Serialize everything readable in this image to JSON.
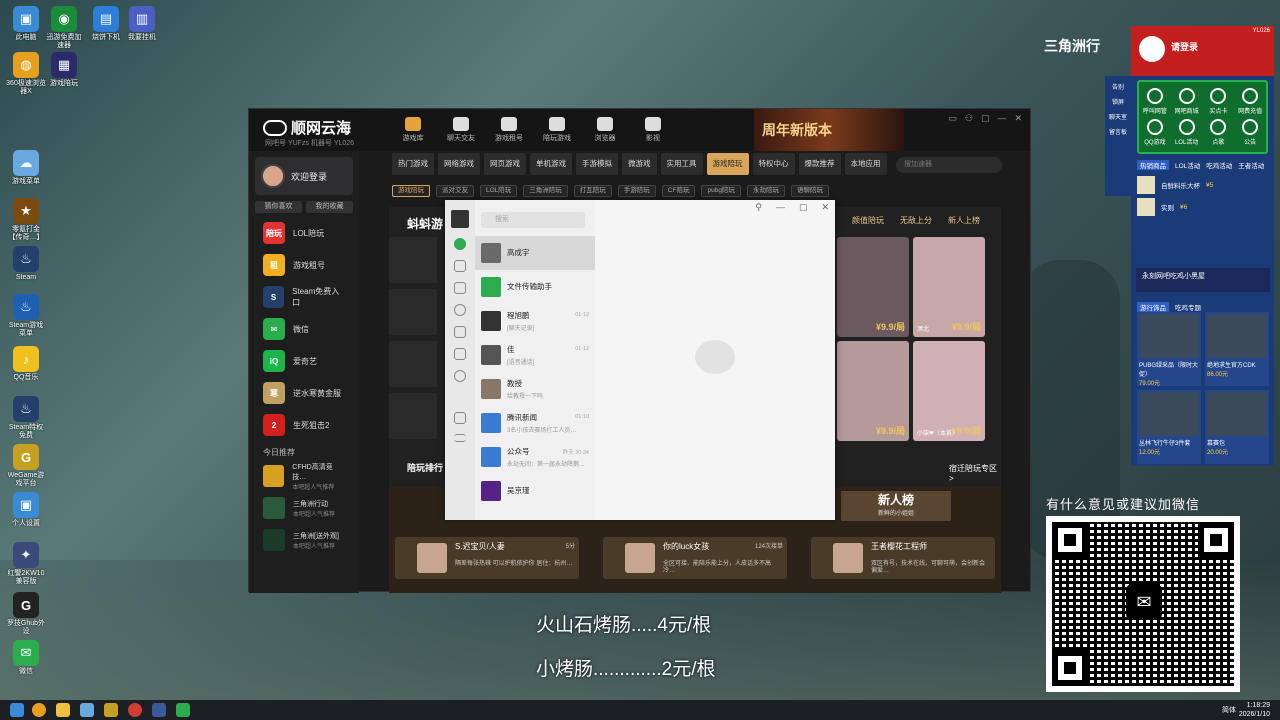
{
  "desktop": {
    "icons": [
      {
        "label": "此电脑",
        "color": "#3a8bd6",
        "glyph": "▣"
      },
      {
        "label": "迅游免费加速器",
        "color": "#1b8c3a",
        "glyph": "◉"
      },
      {
        "label": "烧饼下机",
        "color": "#2d7ed6",
        "glyph": "▤"
      },
      {
        "label": "我要挂机",
        "color": "#4a5fc4",
        "glyph": "▥"
      },
      {
        "label": "360极速浏览器X",
        "color": "#e6a020",
        "glyph": "◍"
      },
      {
        "label": "游戏陪玩",
        "color": "#2b2b6a",
        "glyph": "▦"
      },
      {
        "label": "游戏菜单",
        "color": "#6aa8e0",
        "glyph": "☁"
      },
      {
        "label": "零氪打金【传奇…】",
        "color": "#7a4a10",
        "glyph": "★"
      },
      {
        "label": "Steam",
        "color": "#23406a",
        "glyph": "♨"
      },
      {
        "label": "Steam游戏菜单",
        "color": "#2060b0",
        "glyph": "♨"
      },
      {
        "label": "QQ音乐",
        "color": "#f0c020",
        "glyph": "♪"
      },
      {
        "label": "Steam特权免费",
        "color": "#23406a",
        "glyph": "♨"
      },
      {
        "label": "WeGame游戏平台",
        "color": "#c6a020",
        "glyph": "G"
      },
      {
        "label": "个人设置",
        "color": "#3a8bd6",
        "glyph": "▣"
      },
      {
        "label": "红警2KW10兼容版",
        "color": "#3a4a7a",
        "glyph": "✦"
      },
      {
        "label": "罗技Ghub外设",
        "color": "#222",
        "glyph": "G"
      },
      {
        "label": "微信",
        "color": "#2bad4e",
        "glyph": "✉"
      }
    ]
  },
  "app": {
    "logo_text": "顺网云海",
    "logo_sub": "网吧号 YUFzs  机器号 YL026",
    "topnav": [
      {
        "label": "游戏库",
        "active": true
      },
      {
        "label": "聊天交友"
      },
      {
        "label": "游戏租号"
      },
      {
        "label": "陪玩游戏"
      },
      {
        "label": "浏览器"
      },
      {
        "label": "影视"
      }
    ],
    "anniversary": "周年新版本",
    "window_controls": [
      "▭",
      "⚇",
      "▢",
      "—",
      "✕"
    ],
    "login_text": "欢迎登录",
    "sub_buttons": [
      "猜你喜欢",
      "我的收藏"
    ],
    "side_items": [
      {
        "label": "LOL陪玩",
        "icon": "陪玩",
        "color": "#e03434"
      },
      {
        "label": "游戏租号",
        "icon": "租",
        "color": "#f0b020"
      },
      {
        "label": "Steam免费入口",
        "icon": "S",
        "color": "#23406a"
      },
      {
        "label": "微信",
        "icon": "✉",
        "color": "#2bad4e"
      },
      {
        "label": "爱奇艺",
        "icon": "iQ",
        "color": "#1fb34b"
      },
      {
        "label": "逆水寒黄金服",
        "icon": "寒",
        "color": "#c0a060"
      },
      {
        "label": "生死狙击2",
        "icon": "2",
        "color": "#d02020"
      }
    ],
    "today_title": "今日推荐",
    "rec_items": [
      {
        "title": "CFHD高清竞技…",
        "sub": "本吧超人气推荐",
        "color": "#d8a020"
      },
      {
        "title": "三角洲行动",
        "sub": "本吧超人气推荐",
        "color": "#2a5a3a"
      },
      {
        "title": "三角洲[送外观]",
        "sub": "本吧超人气推荐",
        "color": "#1a3a2a"
      }
    ],
    "categories": [
      {
        "label": "热门游戏"
      },
      {
        "label": "网络游戏"
      },
      {
        "label": "网页游戏"
      },
      {
        "label": "单机游戏"
      },
      {
        "label": "手游模拟"
      },
      {
        "label": "微游戏"
      },
      {
        "label": "实用工具"
      },
      {
        "label": "游戏陪玩",
        "active": true
      },
      {
        "label": "特权中心"
      },
      {
        "label": "爆款推荐"
      },
      {
        "label": "本地应用"
      }
    ],
    "search_placeholder": "搜加速器",
    "subcats": [
      {
        "label": "游戏陪玩",
        "active": true
      },
      {
        "label": "派对交友"
      },
      {
        "label": "LOL陪玩"
      },
      {
        "label": "三角洲陪玩"
      },
      {
        "label": "打瓦陪玩"
      },
      {
        "label": "手游陪玩"
      },
      {
        "label": "CF陪玩"
      },
      {
        "label": "pubg陪玩"
      },
      {
        "label": "永劫陪玩"
      },
      {
        "label": "语聊陪玩"
      }
    ],
    "section_title": "蚪蚪游",
    "right_tabs": [
      "颜值陪玩",
      "无敌上分",
      "新人上榜"
    ],
    "photos": [
      {
        "price": "¥9.9/局",
        "name": "",
        "color": "#6a5a60"
      },
      {
        "price": "¥9.9/局",
        "name": "溟北",
        "color": "#c7a7a7"
      },
      {
        "price": "¥9.9/局",
        "name": "",
        "color": "#b59a9a"
      },
      {
        "price": "¥9.9/局",
        "name": "小柒❤（本首）",
        "color": "#d0b0b5"
      }
    ],
    "rank_title": "陪玩排行",
    "rank_link": "宿迁陪玩专区>",
    "new_rank_title": "新人榜",
    "new_rank_sub": "新鲜的小姐姐",
    "rank_cards": [
      {
        "name": "S.迟宝贝/人妻",
        "desc": "隔差每张热辣 可以护航侬护你 居住：杭州…",
        "time": "5分"
      },
      {
        "name": "你的luck女孩",
        "desc": "全区可接、能陪乐能上分，人皮话多不高冷…",
        "time": "124次接单"
      },
      {
        "name": "王者樱花工程师",
        "desc": "双区有号，技术在线，可聊可萌，会创新会偏爱…",
        "time": ""
      }
    ]
  },
  "wechat": {
    "search_placeholder": "搜索",
    "chats": [
      {
        "name": "高成宇",
        "preview": "",
        "time": "",
        "color": "#6a6a6a",
        "selected": true
      },
      {
        "name": "文件传输助手",
        "preview": "",
        "time": "",
        "color": "#2bad4e"
      },
      {
        "name": "程旭鹏",
        "preview": "[聊天记录]",
        "time": "01:12",
        "color": "#333"
      },
      {
        "name": "佳",
        "preview": "[语音通话]",
        "time": "01:12",
        "color": "#555"
      },
      {
        "name": "教授",
        "preview": "给教授一下吗",
        "time": "",
        "color": "#887766"
      },
      {
        "name": "腾讯新闻",
        "preview": "3名小孩去赛场打工人员…",
        "time": "01:10",
        "color": "#3a7ad0"
      },
      {
        "name": "公众号",
        "preview": "永劫无间：第一届永劫降鹅…",
        "time": "昨天 20:34",
        "color": "#3a7ad0"
      },
      {
        "name": "吴京瑾",
        "preview": "",
        "time": "",
        "color": "#552288"
      }
    ],
    "controls": [
      "⚲",
      "—",
      "▢",
      "✕"
    ]
  },
  "right_panel": {
    "version": "YL026",
    "login_text": "请登录",
    "grid": [
      {
        "label": "呼叫网管"
      },
      {
        "label": "网吧商城"
      },
      {
        "label": "买点卡"
      },
      {
        "label": "网费充值"
      },
      {
        "label": "QQ游戏"
      },
      {
        "label": "LOL活动"
      },
      {
        "label": "点歌"
      },
      {
        "label": "公告"
      }
    ],
    "tabs": [
      {
        "label": "热销商品",
        "active": true
      },
      {
        "label": "LOL活动"
      },
      {
        "label": "吃鸡活动"
      },
      {
        "label": "王者活动"
      }
    ],
    "side_labels": [
      "告别",
      "锁屏",
      "聊天室",
      "留言板"
    ],
    "promo": "永刻网吧吃鸡小黑屋",
    "products": [
      {
        "name": "自鲜料乐大杯",
        "price": "¥5"
      },
      {
        "name": "实则",
        "price": "¥6"
      }
    ],
    "shop_tabs": [
      {
        "label": "游行饰品",
        "active": true
      },
      {
        "label": "吃鸡专题"
      }
    ],
    "items": [
      {
        "name": "PUBG绿采品（限时大促）",
        "price": "79.00元"
      },
      {
        "name": "绝地求生官方CDK",
        "price": "86.00元"
      },
      {
        "name": "丛林飞行牛仔3件套",
        "price": "12.00元"
      },
      {
        "name": "慕赛包",
        "price": "20.00元"
      }
    ]
  },
  "brand": "三角洲行",
  "qr_title": "有什么意见或建议加微信",
  "menu_lines": [
    "火山石烤肠.....4元/根",
    "小烤肠.............2元/根"
  ],
  "taskbar": {
    "lang": "简体",
    "time": "1:18:29",
    "date": "2026/1/10"
  }
}
